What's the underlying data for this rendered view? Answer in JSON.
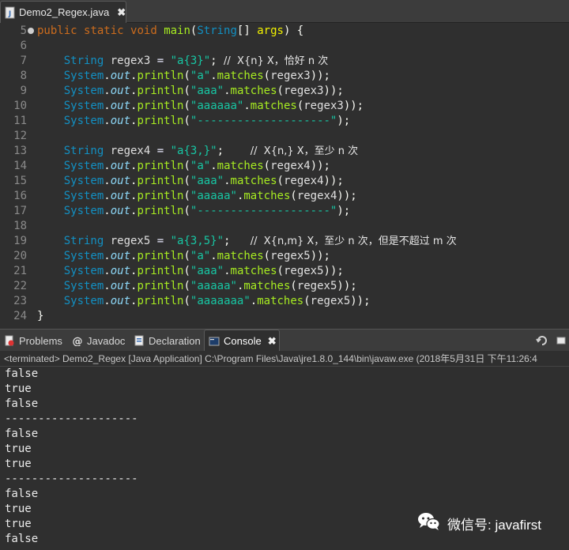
{
  "editor": {
    "tab_label": "Demo2_Regex.java",
    "tab_close": "✖",
    "lines": [
      {
        "num": "5",
        "marker": true,
        "tokens": [
          {
            "c": "kw",
            "t": "public "
          },
          {
            "c": "kw",
            "t": "static "
          },
          {
            "c": "kw",
            "t": "void "
          },
          {
            "c": "meth",
            "t": "main"
          },
          {
            "c": "sep",
            "t": "("
          },
          {
            "c": "ty",
            "t": "String"
          },
          {
            "c": "sep",
            "t": "[] "
          },
          {
            "c": "var",
            "t": "args"
          },
          {
            "c": "sep",
            "t": ") {"
          }
        ]
      },
      {
        "num": "6",
        "tokens": []
      },
      {
        "num": "7",
        "tokens": [
          {
            "c": "ty",
            "t": "    String "
          },
          {
            "c": "loc",
            "t": "regex3"
          },
          {
            "c": "op",
            "t": " = "
          },
          {
            "c": "str",
            "t": "\"a{3}\""
          },
          {
            "c": "sep",
            "t": "; "
          },
          {
            "c": "com",
            "t": "//  X{n} X，恰好 n 次"
          }
        ]
      },
      {
        "num": "8",
        "tokens": [
          {
            "c": "ty",
            "t": "    System"
          },
          {
            "c": "sep",
            "t": "."
          },
          {
            "c": "field",
            "t": "out"
          },
          {
            "c": "sep",
            "t": "."
          },
          {
            "c": "meth",
            "t": "println"
          },
          {
            "c": "sep",
            "t": "("
          },
          {
            "c": "str",
            "t": "\"a\""
          },
          {
            "c": "sep",
            "t": "."
          },
          {
            "c": "meth",
            "t": "matches"
          },
          {
            "c": "sep",
            "t": "("
          },
          {
            "c": "loc",
            "t": "regex3"
          },
          {
            "c": "sep",
            "t": "));"
          }
        ]
      },
      {
        "num": "9",
        "tokens": [
          {
            "c": "ty",
            "t": "    System"
          },
          {
            "c": "sep",
            "t": "."
          },
          {
            "c": "field",
            "t": "out"
          },
          {
            "c": "sep",
            "t": "."
          },
          {
            "c": "meth",
            "t": "println"
          },
          {
            "c": "sep",
            "t": "("
          },
          {
            "c": "str",
            "t": "\"aaa\""
          },
          {
            "c": "sep",
            "t": "."
          },
          {
            "c": "meth",
            "t": "matches"
          },
          {
            "c": "sep",
            "t": "("
          },
          {
            "c": "loc",
            "t": "regex3"
          },
          {
            "c": "sep",
            "t": "));"
          }
        ]
      },
      {
        "num": "10",
        "tokens": [
          {
            "c": "ty",
            "t": "    System"
          },
          {
            "c": "sep",
            "t": "."
          },
          {
            "c": "field",
            "t": "out"
          },
          {
            "c": "sep",
            "t": "."
          },
          {
            "c": "meth",
            "t": "println"
          },
          {
            "c": "sep",
            "t": "("
          },
          {
            "c": "str",
            "t": "\"aaaaaa\""
          },
          {
            "c": "sep",
            "t": "."
          },
          {
            "c": "meth",
            "t": "matches"
          },
          {
            "c": "sep",
            "t": "("
          },
          {
            "c": "loc",
            "t": "regex3"
          },
          {
            "c": "sep",
            "t": "));"
          }
        ]
      },
      {
        "num": "11",
        "tokens": [
          {
            "c": "ty",
            "t": "    System"
          },
          {
            "c": "sep",
            "t": "."
          },
          {
            "c": "field",
            "t": "out"
          },
          {
            "c": "sep",
            "t": "."
          },
          {
            "c": "meth",
            "t": "println"
          },
          {
            "c": "sep",
            "t": "("
          },
          {
            "c": "str",
            "t": "\"--------------------\""
          },
          {
            "c": "sep",
            "t": ");"
          }
        ]
      },
      {
        "num": "12",
        "tokens": []
      },
      {
        "num": "13",
        "tokens": [
          {
            "c": "ty",
            "t": "    String "
          },
          {
            "c": "loc",
            "t": "regex4"
          },
          {
            "c": "op",
            "t": " = "
          },
          {
            "c": "str",
            "t": "\"a{3,}\""
          },
          {
            "c": "sep",
            "t": ";    "
          },
          {
            "c": "com",
            "t": "//  X{n,} X，至少 n 次"
          }
        ]
      },
      {
        "num": "14",
        "tokens": [
          {
            "c": "ty",
            "t": "    System"
          },
          {
            "c": "sep",
            "t": "."
          },
          {
            "c": "field",
            "t": "out"
          },
          {
            "c": "sep",
            "t": "."
          },
          {
            "c": "meth",
            "t": "println"
          },
          {
            "c": "sep",
            "t": "("
          },
          {
            "c": "str",
            "t": "\"a\""
          },
          {
            "c": "sep",
            "t": "."
          },
          {
            "c": "meth",
            "t": "matches"
          },
          {
            "c": "sep",
            "t": "("
          },
          {
            "c": "loc",
            "t": "regex4"
          },
          {
            "c": "sep",
            "t": "));"
          }
        ]
      },
      {
        "num": "15",
        "tokens": [
          {
            "c": "ty",
            "t": "    System"
          },
          {
            "c": "sep",
            "t": "."
          },
          {
            "c": "field",
            "t": "out"
          },
          {
            "c": "sep",
            "t": "."
          },
          {
            "c": "meth",
            "t": "println"
          },
          {
            "c": "sep",
            "t": "("
          },
          {
            "c": "str",
            "t": "\"aaa\""
          },
          {
            "c": "sep",
            "t": "."
          },
          {
            "c": "meth",
            "t": "matches"
          },
          {
            "c": "sep",
            "t": "("
          },
          {
            "c": "loc",
            "t": "regex4"
          },
          {
            "c": "sep",
            "t": "));"
          }
        ]
      },
      {
        "num": "16",
        "tokens": [
          {
            "c": "ty",
            "t": "    System"
          },
          {
            "c": "sep",
            "t": "."
          },
          {
            "c": "field",
            "t": "out"
          },
          {
            "c": "sep",
            "t": "."
          },
          {
            "c": "meth",
            "t": "println"
          },
          {
            "c": "sep",
            "t": "("
          },
          {
            "c": "str",
            "t": "\"aaaaa\""
          },
          {
            "c": "sep",
            "t": "."
          },
          {
            "c": "meth",
            "t": "matches"
          },
          {
            "c": "sep",
            "t": "("
          },
          {
            "c": "loc",
            "t": "regex4"
          },
          {
            "c": "sep",
            "t": "));"
          }
        ]
      },
      {
        "num": "17",
        "tokens": [
          {
            "c": "ty",
            "t": "    System"
          },
          {
            "c": "sep",
            "t": "."
          },
          {
            "c": "field",
            "t": "out"
          },
          {
            "c": "sep",
            "t": "."
          },
          {
            "c": "meth",
            "t": "println"
          },
          {
            "c": "sep",
            "t": "("
          },
          {
            "c": "str",
            "t": "\"--------------------\""
          },
          {
            "c": "sep",
            "t": ");"
          }
        ]
      },
      {
        "num": "18",
        "tokens": []
      },
      {
        "num": "19",
        "tokens": [
          {
            "c": "ty",
            "t": "    String "
          },
          {
            "c": "loc",
            "t": "regex5"
          },
          {
            "c": "op",
            "t": " = "
          },
          {
            "c": "str",
            "t": "\"a{3,5}\""
          },
          {
            "c": "sep",
            "t": ";   "
          },
          {
            "c": "com",
            "t": "//  X{n,m} X，至少 n 次，但是不超过 m 次"
          }
        ]
      },
      {
        "num": "20",
        "tokens": [
          {
            "c": "ty",
            "t": "    System"
          },
          {
            "c": "sep",
            "t": "."
          },
          {
            "c": "field",
            "t": "out"
          },
          {
            "c": "sep",
            "t": "."
          },
          {
            "c": "meth",
            "t": "println"
          },
          {
            "c": "sep",
            "t": "("
          },
          {
            "c": "str",
            "t": "\"a\""
          },
          {
            "c": "sep",
            "t": "."
          },
          {
            "c": "meth",
            "t": "matches"
          },
          {
            "c": "sep",
            "t": "("
          },
          {
            "c": "loc",
            "t": "regex5"
          },
          {
            "c": "sep",
            "t": "));"
          }
        ]
      },
      {
        "num": "21",
        "tokens": [
          {
            "c": "ty",
            "t": "    System"
          },
          {
            "c": "sep",
            "t": "."
          },
          {
            "c": "field",
            "t": "out"
          },
          {
            "c": "sep",
            "t": "."
          },
          {
            "c": "meth",
            "t": "println"
          },
          {
            "c": "sep",
            "t": "("
          },
          {
            "c": "str",
            "t": "\"aaa\""
          },
          {
            "c": "sep",
            "t": "."
          },
          {
            "c": "meth",
            "t": "matches"
          },
          {
            "c": "sep",
            "t": "("
          },
          {
            "c": "loc",
            "t": "regex5"
          },
          {
            "c": "sep",
            "t": "));"
          }
        ]
      },
      {
        "num": "22",
        "tokens": [
          {
            "c": "ty",
            "t": "    System"
          },
          {
            "c": "sep",
            "t": "."
          },
          {
            "c": "field",
            "t": "out"
          },
          {
            "c": "sep",
            "t": "."
          },
          {
            "c": "meth",
            "t": "println"
          },
          {
            "c": "sep",
            "t": "("
          },
          {
            "c": "str",
            "t": "\"aaaaa\""
          },
          {
            "c": "sep",
            "t": "."
          },
          {
            "c": "meth",
            "t": "matches"
          },
          {
            "c": "sep",
            "t": "("
          },
          {
            "c": "loc",
            "t": "regex5"
          },
          {
            "c": "sep",
            "t": "));"
          }
        ]
      },
      {
        "num": "23",
        "tokens": [
          {
            "c": "ty",
            "t": "    System"
          },
          {
            "c": "sep",
            "t": "."
          },
          {
            "c": "field",
            "t": "out"
          },
          {
            "c": "sep",
            "t": "."
          },
          {
            "c": "meth",
            "t": "println"
          },
          {
            "c": "sep",
            "t": "("
          },
          {
            "c": "str",
            "t": "\"aaaaaaa\""
          },
          {
            "c": "sep",
            "t": "."
          },
          {
            "c": "meth",
            "t": "matches"
          },
          {
            "c": "sep",
            "t": "("
          },
          {
            "c": "loc",
            "t": "regex5"
          },
          {
            "c": "sep",
            "t": "));"
          }
        ]
      },
      {
        "num": "24",
        "tokens": [
          {
            "c": "sep",
            "t": "}"
          }
        ]
      }
    ]
  },
  "panel": {
    "tabs": [
      {
        "label": "Problems",
        "icon": "problems-icon",
        "active": false
      },
      {
        "label": "Javadoc",
        "icon": "javadoc-icon",
        "active": false
      },
      {
        "label": "Declaration",
        "icon": "declaration-icon",
        "active": false
      },
      {
        "label": "Console",
        "icon": "console-icon",
        "active": true,
        "close": "✖"
      }
    ]
  },
  "console": {
    "status": "<terminated> Demo2_Regex [Java Application] C:\\Program Files\\Java\\jre1.8.0_144\\bin\\javaw.exe (2018年5月31日 下午11:26:4",
    "output": [
      "false",
      "true",
      "false",
      "--------------------",
      "false",
      "true",
      "true",
      "--------------------",
      "false",
      "true",
      "true",
      "false"
    ]
  },
  "watermark": {
    "text": "微信号: javafirst"
  }
}
